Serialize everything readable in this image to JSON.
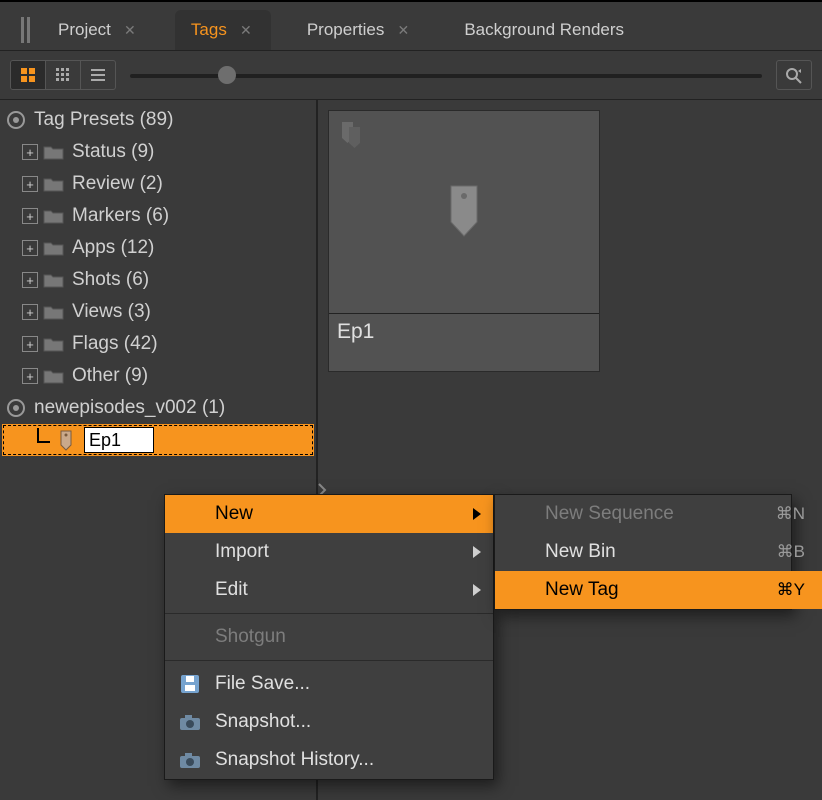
{
  "tabs": [
    {
      "label": "Project",
      "active": false,
      "closable": true
    },
    {
      "label": "Tags",
      "active": true,
      "closable": true
    },
    {
      "label": "Properties",
      "active": false,
      "closable": true
    },
    {
      "label": "Background Renders",
      "active": false,
      "closable": false
    }
  ],
  "slider_pos_pct": 14,
  "tree": {
    "presets": {
      "label": "Tag Presets (89)"
    },
    "folders": [
      {
        "label": "Status (9)"
      },
      {
        "label": "Review (2)"
      },
      {
        "label": "Markers (6)"
      },
      {
        "label": "Apps (12)"
      },
      {
        "label": "Shots (6)"
      },
      {
        "label": "Views (3)"
      },
      {
        "label": "Flags (42)"
      },
      {
        "label": "Other (9)"
      }
    ],
    "userfile": {
      "label": "newepisodes_v002 (1)"
    },
    "selected_tag_name": "Ep1"
  },
  "preview": {
    "label": "Ep1"
  },
  "contextmenu": {
    "items": [
      {
        "label": "New",
        "hassub": true,
        "hl": true
      },
      {
        "label": "Import",
        "hassub": true
      },
      {
        "label": "Edit",
        "hassub": true
      },
      {
        "label": "Shotgun",
        "disabled": true
      },
      {
        "label": "File Save...",
        "icon": "disk"
      },
      {
        "label": "Snapshot...",
        "icon": "camera"
      },
      {
        "label": "Snapshot History...",
        "icon": "camera"
      }
    ],
    "submenu": [
      {
        "label": "New Sequence",
        "shortcut": "⌘N",
        "disabled": true
      },
      {
        "label": "New Bin",
        "shortcut": "⌘B"
      },
      {
        "label": "New Tag",
        "shortcut": "⌘Y",
        "hl": true
      }
    ]
  }
}
